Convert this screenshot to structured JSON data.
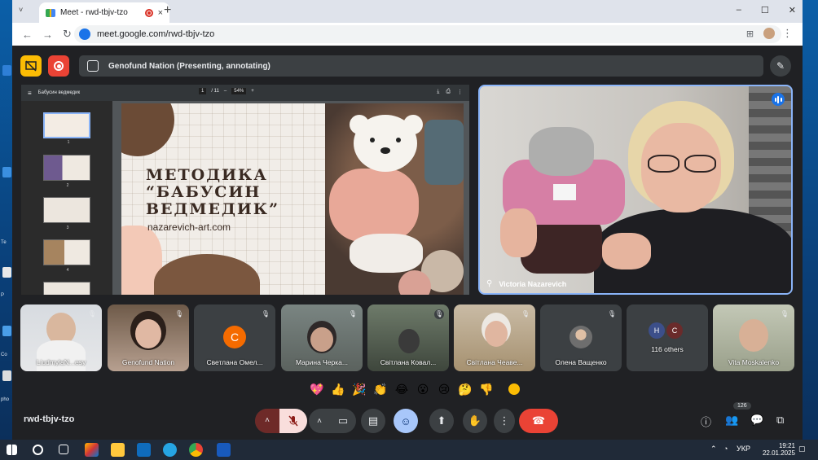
{
  "browser": {
    "tab_title": "Meet - rwd-tbjv-tzo",
    "tab_list_icon": "˅",
    "tab_close": "×",
    "new_tab": "+",
    "window_controls": [
      "–",
      "☐",
      "✕"
    ],
    "nav": {
      "back": "←",
      "forward": "→",
      "reload": "↻"
    },
    "url": "meet.google.com/rwd-tbjv-tzo",
    "toolbar_icons": {
      "translate": "⊞",
      "bookmark": "☆",
      "menu": "⋮"
    }
  },
  "presentation": {
    "presenter_label": "Genofund Nation (Presenting, annotating)",
    "annotate_icon": "✎",
    "pdf": {
      "file_name": "Бабусин ведмедик",
      "menu_icon": "≡",
      "page_current": "1",
      "page_total": "/ 11",
      "zoom_minus": "–",
      "zoom": "54%",
      "zoom_plus": "+",
      "right_icons": [
        "⤓",
        "⎙",
        "⋮"
      ],
      "thumbnails": [
        "1",
        "2",
        "3",
        "4"
      ]
    },
    "slide": {
      "title_lines": [
        "МЕТОДИКА",
        "“БАБУСИН",
        "ВЕДМЕДИК”"
      ],
      "website": "nazarevich-art.com"
    }
  },
  "speaker": {
    "name": "Victoria Nazarevich",
    "pin_icon": "⚲"
  },
  "participants": [
    {
      "name": "LiudmylaN...esy",
      "kind": "video"
    },
    {
      "name": "Genofund Nation",
      "kind": "video"
    },
    {
      "name": "Светлана Омел...",
      "kind": "avatar",
      "letter": "С",
      "color": "#f56b00"
    },
    {
      "name": "Марина Черка...",
      "kind": "video"
    },
    {
      "name": "Світлана Ковал...",
      "kind": "video"
    },
    {
      "name": "Світлана Чеаве...",
      "kind": "video"
    },
    {
      "name": "Олена Ващенко",
      "kind": "photo"
    },
    {
      "name": "116 others",
      "kind": "others",
      "letters": [
        "Н",
        "С"
      ],
      "colors": [
        "#3c4f8a",
        "#6a2b2b"
      ]
    },
    {
      "name": "Vita Moskalenko",
      "kind": "video"
    }
  ],
  "reactions": [
    "💖",
    "👍",
    "🎉",
    "👏",
    "😂",
    "😮",
    "😢",
    "🤔",
    "👎"
  ],
  "controls": {
    "meeting_code": "rwd-tbjv-tzo",
    "participants_count": "126",
    "icons": {
      "mic_more": "˄",
      "mic": "🎙",
      "cam_more": "˄",
      "camera": "▭",
      "captions": "▤",
      "emoji": "☺",
      "present": "⬆",
      "raise_hand": "✋",
      "more": "⋮",
      "hangup": "☎",
      "info": "ⓘ",
      "people": "👥",
      "chat": "💬",
      "activities": "⧉"
    }
  },
  "taskbar": {
    "language": "УКР",
    "time": "19:21",
    "date": "22.01.2025"
  },
  "desktop_labels": [
    "Те",
    "Р",
    "Co",
    "pho"
  ]
}
